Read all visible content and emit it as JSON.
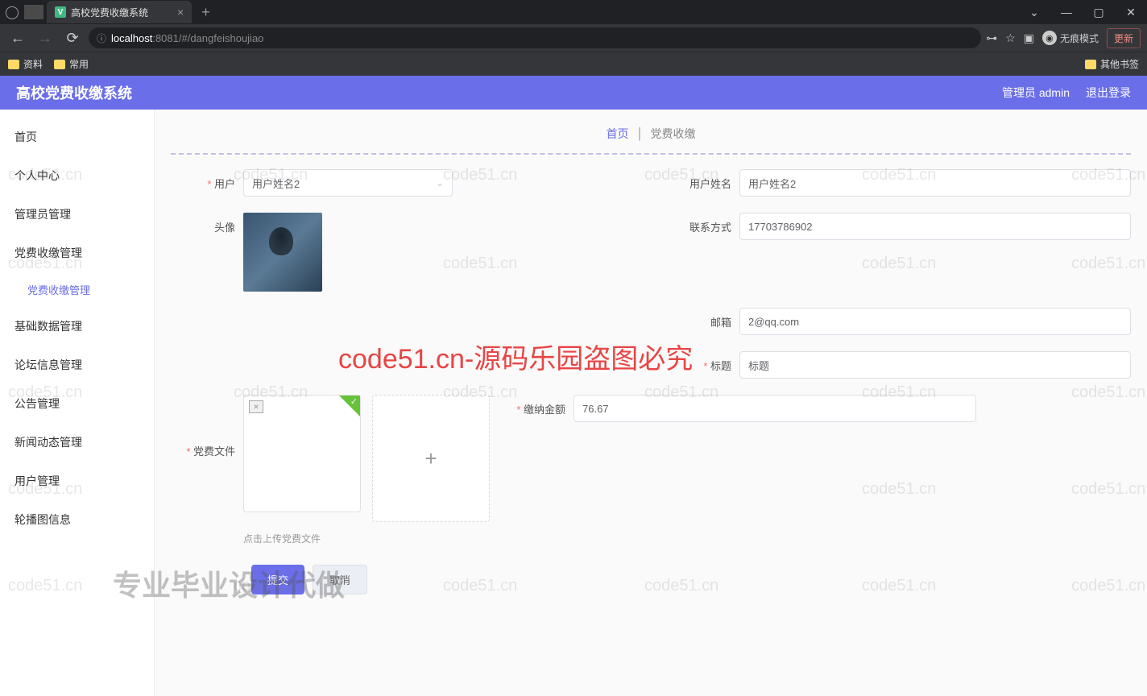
{
  "browser": {
    "tab_title": "高校党费收缴系统",
    "url_host": "localhost",
    "url_port": ":8081",
    "url_path": "/#/dangfeishoujiao",
    "incognito": "无痕模式",
    "update": "更新",
    "bookmarks": [
      "资料",
      "常用"
    ],
    "bookmark_right": "其他书签"
  },
  "header": {
    "title": "高校党费收缴系统",
    "user": "管理员 admin",
    "logout": "退出登录"
  },
  "sidebar": {
    "items": [
      "首页",
      "个人中心",
      "管理员管理",
      "党费收缴管理",
      "基础数据管理",
      "论坛信息管理",
      "公告管理",
      "新闻动态管理",
      "用户管理",
      "轮播图信息"
    ],
    "sub": "党费收缴管理"
  },
  "breadcrumb": {
    "home": "首页",
    "current": "党费收缴"
  },
  "form": {
    "user_label": "用户",
    "user_value": "用户姓名2",
    "username_label": "用户姓名",
    "username_value": "用户姓名2",
    "avatar_label": "头像",
    "phone_label": "联系方式",
    "phone_value": "17703786902",
    "email_label": "邮箱",
    "email_value": "2@qq.com",
    "title_label": "标题",
    "title_value": "标题",
    "amount_label": "缴纳金额",
    "amount_value": "76.67",
    "file_label": "党费文件",
    "upload_hint": "点击上传党费文件",
    "submit": "提交",
    "cancel": "取消"
  },
  "watermarks": {
    "main": "code51.cn-源码乐园盗图必究",
    "bottom": "专业毕业设计代做",
    "repeat": "code51.cn"
  }
}
